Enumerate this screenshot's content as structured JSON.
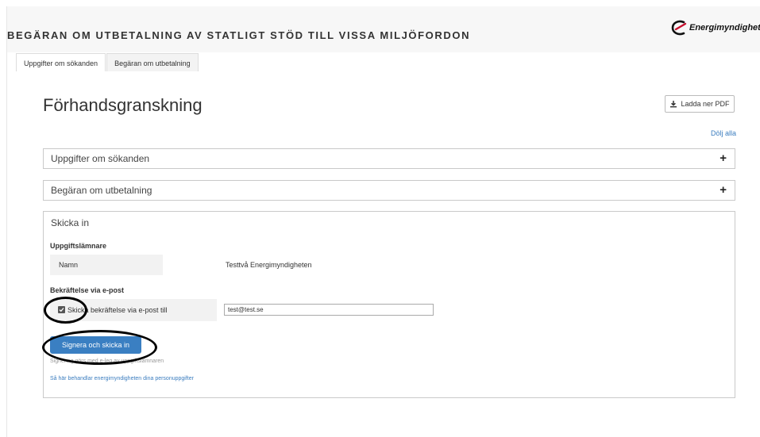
{
  "app": {
    "title": "BEGÄRAN OM UTBETALNING AV STATLIGT STÖD TILL VISSA MILJÖFORDON",
    "logo_text": "Energimyndigheten"
  },
  "tabs": [
    {
      "label": "Uppgifter om sökanden"
    },
    {
      "label": "Begäran om utbetalning"
    }
  ],
  "page": {
    "title": "Förhandsgranskning",
    "download_pdf_label": "Ladda ner PDF",
    "hide_all_label": "Dölj alla"
  },
  "panels": {
    "applicant": {
      "title": "Uppgifter om sökanden",
      "toggle": "+"
    },
    "payout": {
      "title": "Begäran om utbetalning",
      "toggle": "+"
    },
    "submit": {
      "title": "Skicka in",
      "submitter_heading": "Uppgiftslämnare",
      "name_label": "Namn",
      "name_value": "Testtvå Energimyndigheten",
      "confirm_heading": "Bekräftelse via e-post",
      "confirm_checkbox_label": "Skicka bekräftelse via e-post till",
      "confirm_checked": true,
      "email_value": "test@test.se",
      "sign_button_label": "Signera och skicka in",
      "sign_note": "Signering görs med e-leg av uppgiftslämnaren",
      "privacy_link": "Så här behandlar energimyndigheten dina personuppgifter"
    }
  },
  "icons": {
    "download": "download-icon",
    "checkbox": "check-icon",
    "logo": "energimyndigheten-logo-icon"
  },
  "colors": {
    "primary_button": "#3a7fc2",
    "link": "#3b7dbf",
    "annotation": "#000000"
  }
}
